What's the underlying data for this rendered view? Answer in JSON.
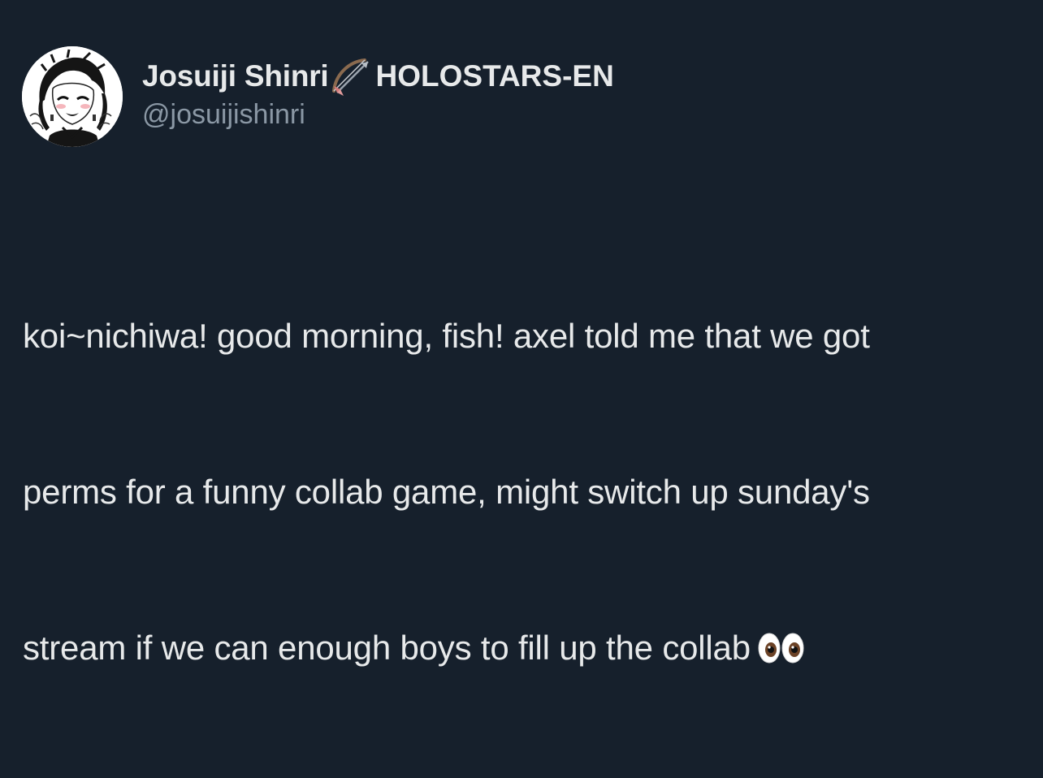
{
  "author": {
    "display_name": "Josuiji Shinri",
    "name_emoji": "bow-and-arrow-icon",
    "org_tag": "HOLOSTARS-EN",
    "handle": "@josuijishinri",
    "avatar": "avatar-illustration"
  },
  "tweet": {
    "lines": [
      "koi~nichiwa! good morning, fish! axel told me that we got",
      "perms for a funny collab game, might switch up sunday's",
      "stream if we can enough boys to fill up the collab"
    ],
    "trailing_emoji": "eyes-icon"
  },
  "colors": {
    "background": "#16202c",
    "primary_text": "#e7e9ea",
    "secondary_text": "#8b98a5"
  }
}
